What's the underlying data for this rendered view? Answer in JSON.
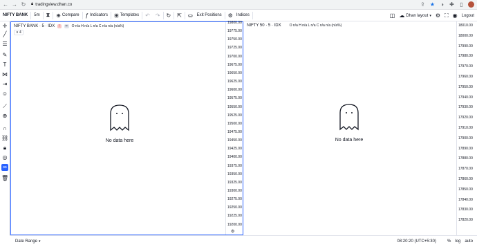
{
  "browser": {
    "url": "tradingview.dhan.co",
    "icons": [
      "back-icon",
      "forward-icon",
      "reload-icon",
      "lock-icon",
      "share-icon",
      "star-icon",
      "extension-icon",
      "puzzle-icon",
      "sidepanel-icon",
      "avatar"
    ]
  },
  "toolbar": {
    "symbol": "NIFTY BANK",
    "interval": "5m",
    "compare_label": "Compare",
    "indicators_label": "Indicators",
    "templates_label": "Templates",
    "exit_positions_label": "Exit Positions",
    "indices_label": "Indices",
    "layout_label": "Dhan layout",
    "logout_label": "Logout"
  },
  "pane_left": {
    "legend_title": "NIFTY BANK · 5 · IDX",
    "badge": "!",
    "ohlc": "O n/a H n/a L n/a C n/a n/a (n/a%)",
    "collapse": "∨ 4",
    "no_data": "No data here",
    "axis": [
      "19800.00",
      "19775.00",
      "19750.00",
      "19725.00",
      "19700.00",
      "19675.00",
      "19650.00",
      "19625.00",
      "19600.00",
      "19575.00",
      "19550.00",
      "19525.00",
      "19500.00",
      "19475.00",
      "19450.00",
      "19425.00",
      "19400.00",
      "19375.00",
      "19350.00",
      "19325.00",
      "19300.00",
      "19275.00",
      "19250.00",
      "19225.00",
      "19200.00"
    ]
  },
  "pane_right": {
    "legend_title": "NIFTY 50 · 5 · IDX",
    "ohlc": "O n/a H n/a L n/a C n/a n/a (n/a%)",
    "no_data": "No data here",
    "axis": [
      "18010.00",
      "18000.00",
      "17990.00",
      "17980.00",
      "17970.00",
      "17960.00",
      "17950.00",
      "17940.00",
      "17930.00",
      "17920.00",
      "17910.00",
      "17900.00",
      "17890.00",
      "17880.00",
      "17870.00",
      "17860.00",
      "17850.00",
      "17840.00",
      "17830.00",
      "17820.00"
    ]
  },
  "bottom": {
    "date_range": "Date Range",
    "time": "08:20:20 (UTC+5:30)",
    "percent": "%",
    "log": "log",
    "auto": "auto"
  },
  "colors": {
    "accent": "#2962ff",
    "badge_red": "#d32f2f"
  }
}
